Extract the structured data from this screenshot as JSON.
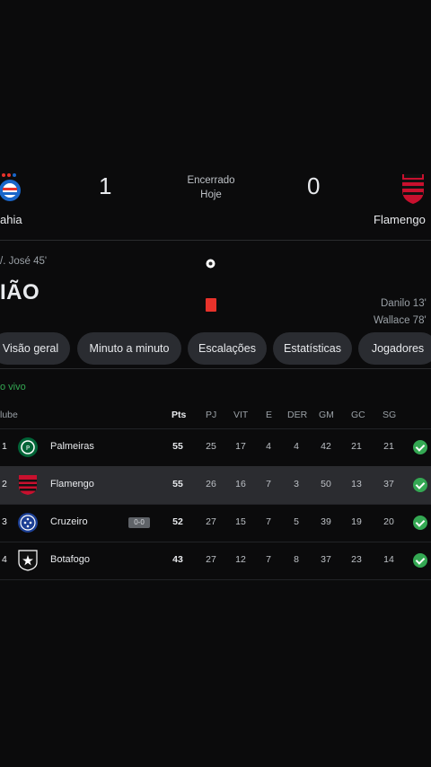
{
  "match": {
    "home_team": "ahia",
    "away_team": "Flamengo",
    "home_score": "1",
    "away_score": "0",
    "status": "Encerrado",
    "day": "Hoje"
  },
  "events": {
    "home_scorer": "/. José 45'",
    "away_scorers": [
      "Danilo 13'",
      "Wallace 78'"
    ],
    "big_text": "IÃO"
  },
  "tabs": [
    "Visão geral",
    "Minuto a minuto",
    "Escalações",
    "Estatísticas",
    "Jogadores"
  ],
  "live_label": "o vivo",
  "table": {
    "headers": {
      "club": "lube",
      "pts": "Pts",
      "pj": "PJ",
      "vit": "VIT",
      "e": "E",
      "der": "DER",
      "gm": "GM",
      "gc": "GC",
      "sg": "SG"
    },
    "rows": [
      {
        "rank": "1",
        "name": "Palmeiras",
        "pts": "55",
        "pj": "25",
        "vit": "17",
        "e": "4",
        "der": "4",
        "gm": "42",
        "gc": "21",
        "sg": "21",
        "badge": ""
      },
      {
        "rank": "2",
        "name": "Flamengo",
        "pts": "55",
        "pj": "26",
        "vit": "16",
        "e": "7",
        "der": "3",
        "gm": "50",
        "gc": "13",
        "sg": "37",
        "badge": ""
      },
      {
        "rank": "3",
        "name": "Cruzeiro",
        "pts": "52",
        "pj": "27",
        "vit": "15",
        "e": "7",
        "der": "5",
        "gm": "39",
        "gc": "19",
        "sg": "20",
        "badge": "0-0"
      },
      {
        "rank": "4",
        "name": "Botafogo",
        "pts": "43",
        "pj": "27",
        "vit": "12",
        "e": "7",
        "der": "8",
        "gm": "37",
        "gc": "23",
        "sg": "14",
        "badge": ""
      }
    ]
  },
  "colors": {
    "accent_green": "#34a853",
    "red_card": "#e8322b",
    "background": "#0b0b0c"
  }
}
